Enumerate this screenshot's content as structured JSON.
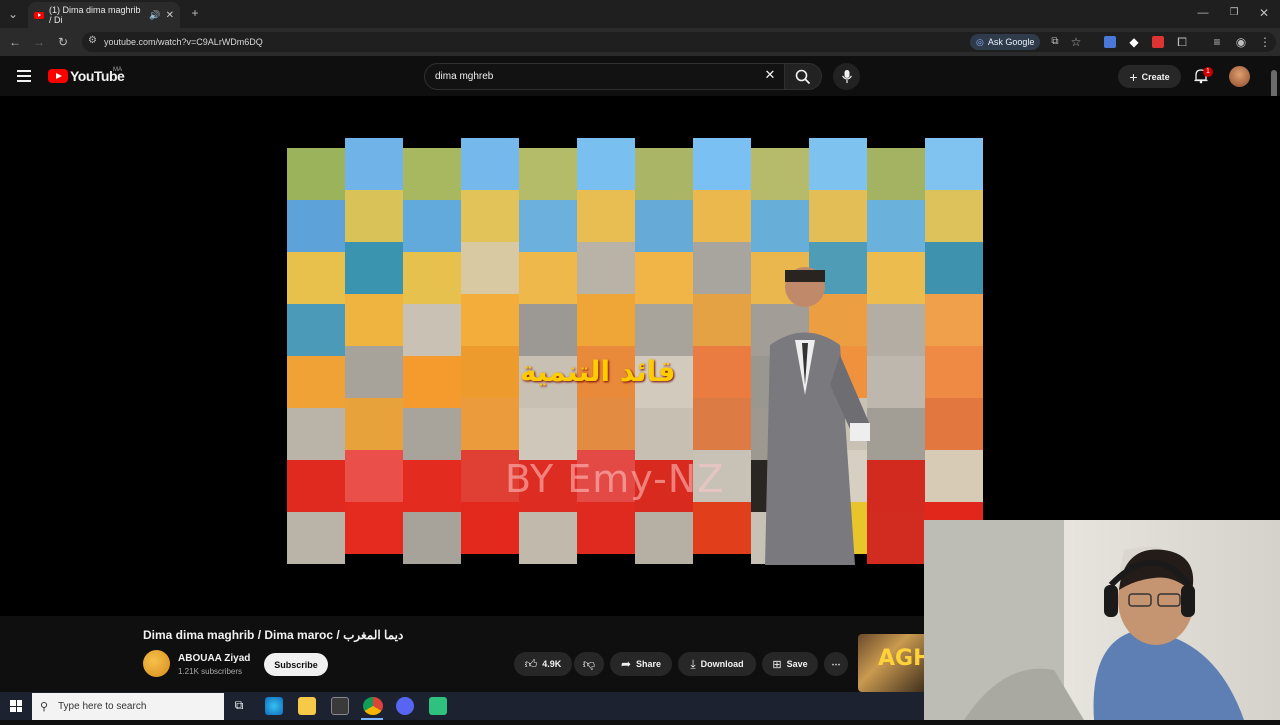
{
  "browser": {
    "tab_title": "(1) Dima dima maghrib / Di",
    "url": "youtube.com/watch?v=C9ALrWDm6DQ",
    "ask_google": "Ask Google"
  },
  "youtube": {
    "logo_text": "YouTube",
    "region": "MA",
    "search_value": "dima mghreb",
    "create_label": "Create",
    "notification_count": "1"
  },
  "video": {
    "watermark": "BY  Emy-NZ",
    "overlay_text": "قائد التنمية",
    "title": "Dima dima maghrib / Dima maroc / ديما المغرب",
    "channel": "ABOUAA Ziyad",
    "subscribers": "1.21K subscribers",
    "subscribe_label": "Subscribe",
    "likes": "4.9K",
    "share_label": "Share",
    "download_label": "Download",
    "save_label": "Save",
    "more_label": "⋯",
    "thumb_text": "AGH"
  },
  "taskbar": {
    "search_placeholder": "Type here to search"
  }
}
